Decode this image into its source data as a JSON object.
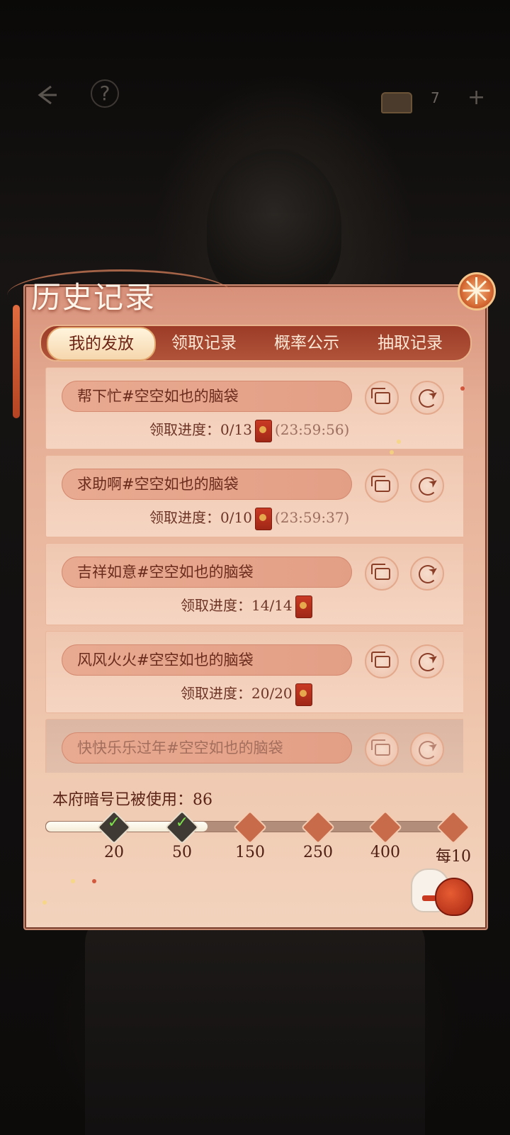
{
  "top_bar": {
    "back_icon": "back-arrow-icon",
    "help_label": "?",
    "currency_icon": "treasure-chest-icon",
    "currency_count": "7",
    "add_label": "+"
  },
  "panel": {
    "title": "历史记录",
    "close_icon": "fan-close-icon"
  },
  "tabs": [
    {
      "label": "我的发放",
      "active": true
    },
    {
      "label": "领取记录",
      "active": false
    },
    {
      "label": "概率公示",
      "active": false
    },
    {
      "label": "抽取记录",
      "active": false
    }
  ],
  "records": [
    {
      "title": "帮下忙#空空如也的脑袋",
      "progress_label": "领取进度：",
      "progress": "0/13",
      "timer": "(23:59:56)"
    },
    {
      "title": "求助啊#空空如也的脑袋",
      "progress_label": "领取进度：",
      "progress": "0/10",
      "timer": "(23:59:37)"
    },
    {
      "title": "吉祥如意#空空如也的脑袋",
      "progress_label": "领取进度：",
      "progress": "14/14",
      "timer": ""
    },
    {
      "title": "风风火火#空空如也的脑袋",
      "progress_label": "领取进度：",
      "progress": "20/20",
      "timer": ""
    },
    {
      "title": "快快乐乐过年#空空如也的脑袋",
      "progress_label": "",
      "progress": "",
      "timer": ""
    }
  ],
  "usage": {
    "label": "本府暗号已被使用：86",
    "value": 86,
    "milestones": [
      {
        "label": "20",
        "claimed": true
      },
      {
        "label": "50",
        "claimed": true
      },
      {
        "label": "150",
        "claimed": false
      },
      {
        "label": "250",
        "claimed": false
      },
      {
        "label": "400",
        "claimed": false
      },
      {
        "label": "每10",
        "claimed": false
      }
    ]
  },
  "colors": {
    "panel_top": "#d8917b",
    "panel_bottom": "#f3d3bd",
    "tab_bar": "#9c3c28",
    "text_dark": "#6a2b1c"
  }
}
